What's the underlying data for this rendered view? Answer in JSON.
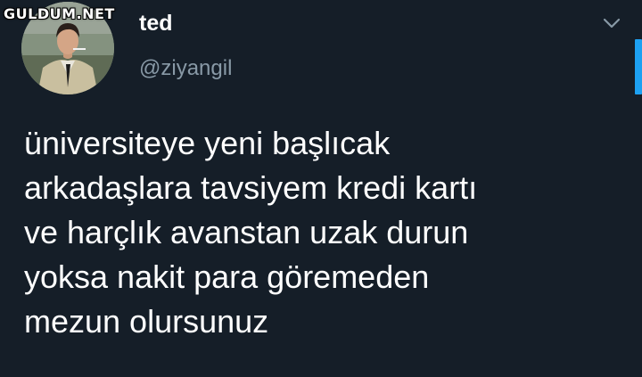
{
  "watermark": "GULDUM.NET",
  "user": {
    "display_name": "ted",
    "handle": "@ziyangil"
  },
  "tweet": {
    "text": "üniversiteye yeni başlıcak\narkadaşlara tavsiyem kredi kartı\nve harçlık avanstan uzak durun\nyoksa nakit para göremeden\nmezun olursunuz"
  },
  "icons": {
    "menu": "chevron-down-icon",
    "avatar": "profile-photo"
  },
  "colors": {
    "background": "#151e28",
    "secondary_text": "#8899a6",
    "accent": "#1da1f2"
  }
}
